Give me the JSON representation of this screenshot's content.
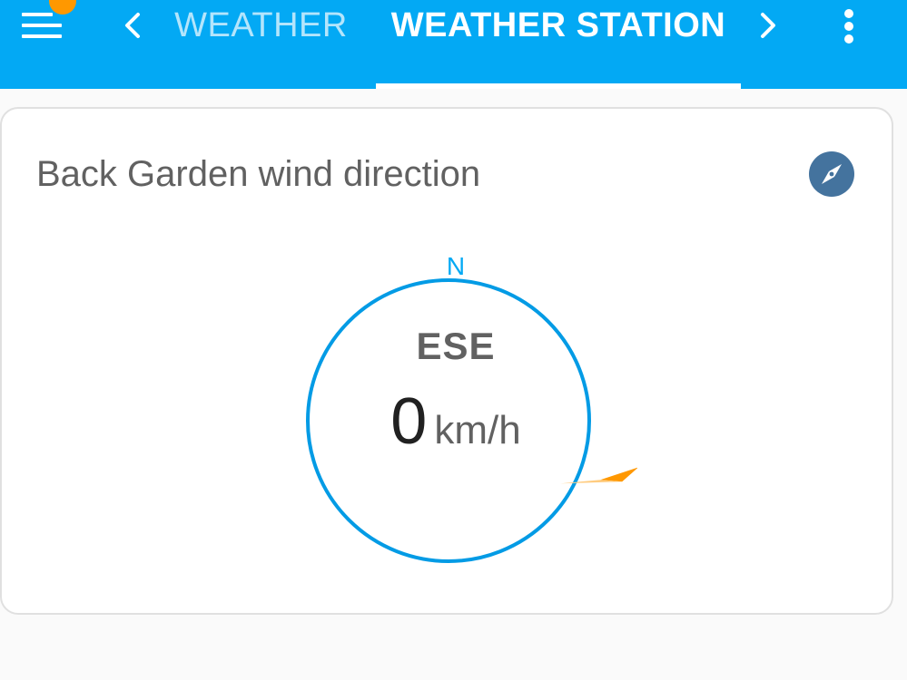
{
  "header": {
    "menu_icon": "menu-icon",
    "notification_color": "#ff9800",
    "prev_icon": "chevron-left-icon",
    "next_icon": "chevron-right-icon",
    "overflow_icon": "more-vert-icon",
    "tabs": [
      {
        "label": "WEATHER",
        "active": false
      },
      {
        "label": "WEATHER STATION",
        "active": true
      }
    ],
    "accent_color": "#03a9f4"
  },
  "card": {
    "title": "Back Garden wind direction",
    "icon": "compass-icon",
    "icon_color": "#44739e",
    "compass": {
      "north_label": "N",
      "direction": "ESE",
      "bearing_degrees": 112.5,
      "speed_value": "0",
      "speed_unit": "km/h",
      "ring_color": "#039be5",
      "pointer_color": "#ff9800"
    }
  }
}
